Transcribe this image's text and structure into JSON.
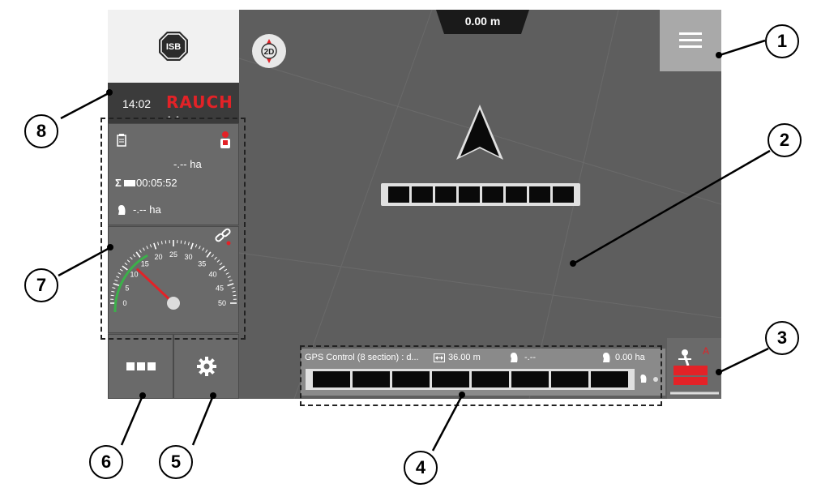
{
  "header": {
    "time": "14:02",
    "brand": "RAUCH",
    "isb_label": "ISB",
    "dots": "• •"
  },
  "distance": "0.00 m",
  "compass_label": "2D",
  "stats": {
    "area_partial": "-.-- ha",
    "time_total": "00:05:52",
    "area_total": "-.-- ha",
    "sigma_label": "Σ"
  },
  "speedometer": {
    "tick_labels": [
      "0",
      "5",
      "10",
      "15",
      "20",
      "25",
      "30",
      "35",
      "40",
      "45",
      "50"
    ],
    "needle_value": 12
  },
  "gps_bar": {
    "title": "GPS Control (8 section) : d...",
    "width": "36.00 m",
    "remaining": "-.--",
    "area": "0.00 ha",
    "sections_count": 8
  },
  "map_sections_count": 8,
  "callouts": [
    "1",
    "2",
    "3",
    "4",
    "5",
    "6",
    "7",
    "8"
  ],
  "colors": {
    "accent": "#e32227",
    "screen": "#5e5e5e",
    "panel": "#6a6a6a",
    "speed_green": "#3cb04a"
  },
  "icons": [
    "isb-icon",
    "compass-2d-icon",
    "hamburger-menu-icon",
    "arrow-position-icon",
    "clipboard-icon",
    "operator-icon",
    "field-icon",
    "gear-icon",
    "more-dots-icon",
    "auto-mode-icon",
    "width-icon",
    "link-icon"
  ]
}
